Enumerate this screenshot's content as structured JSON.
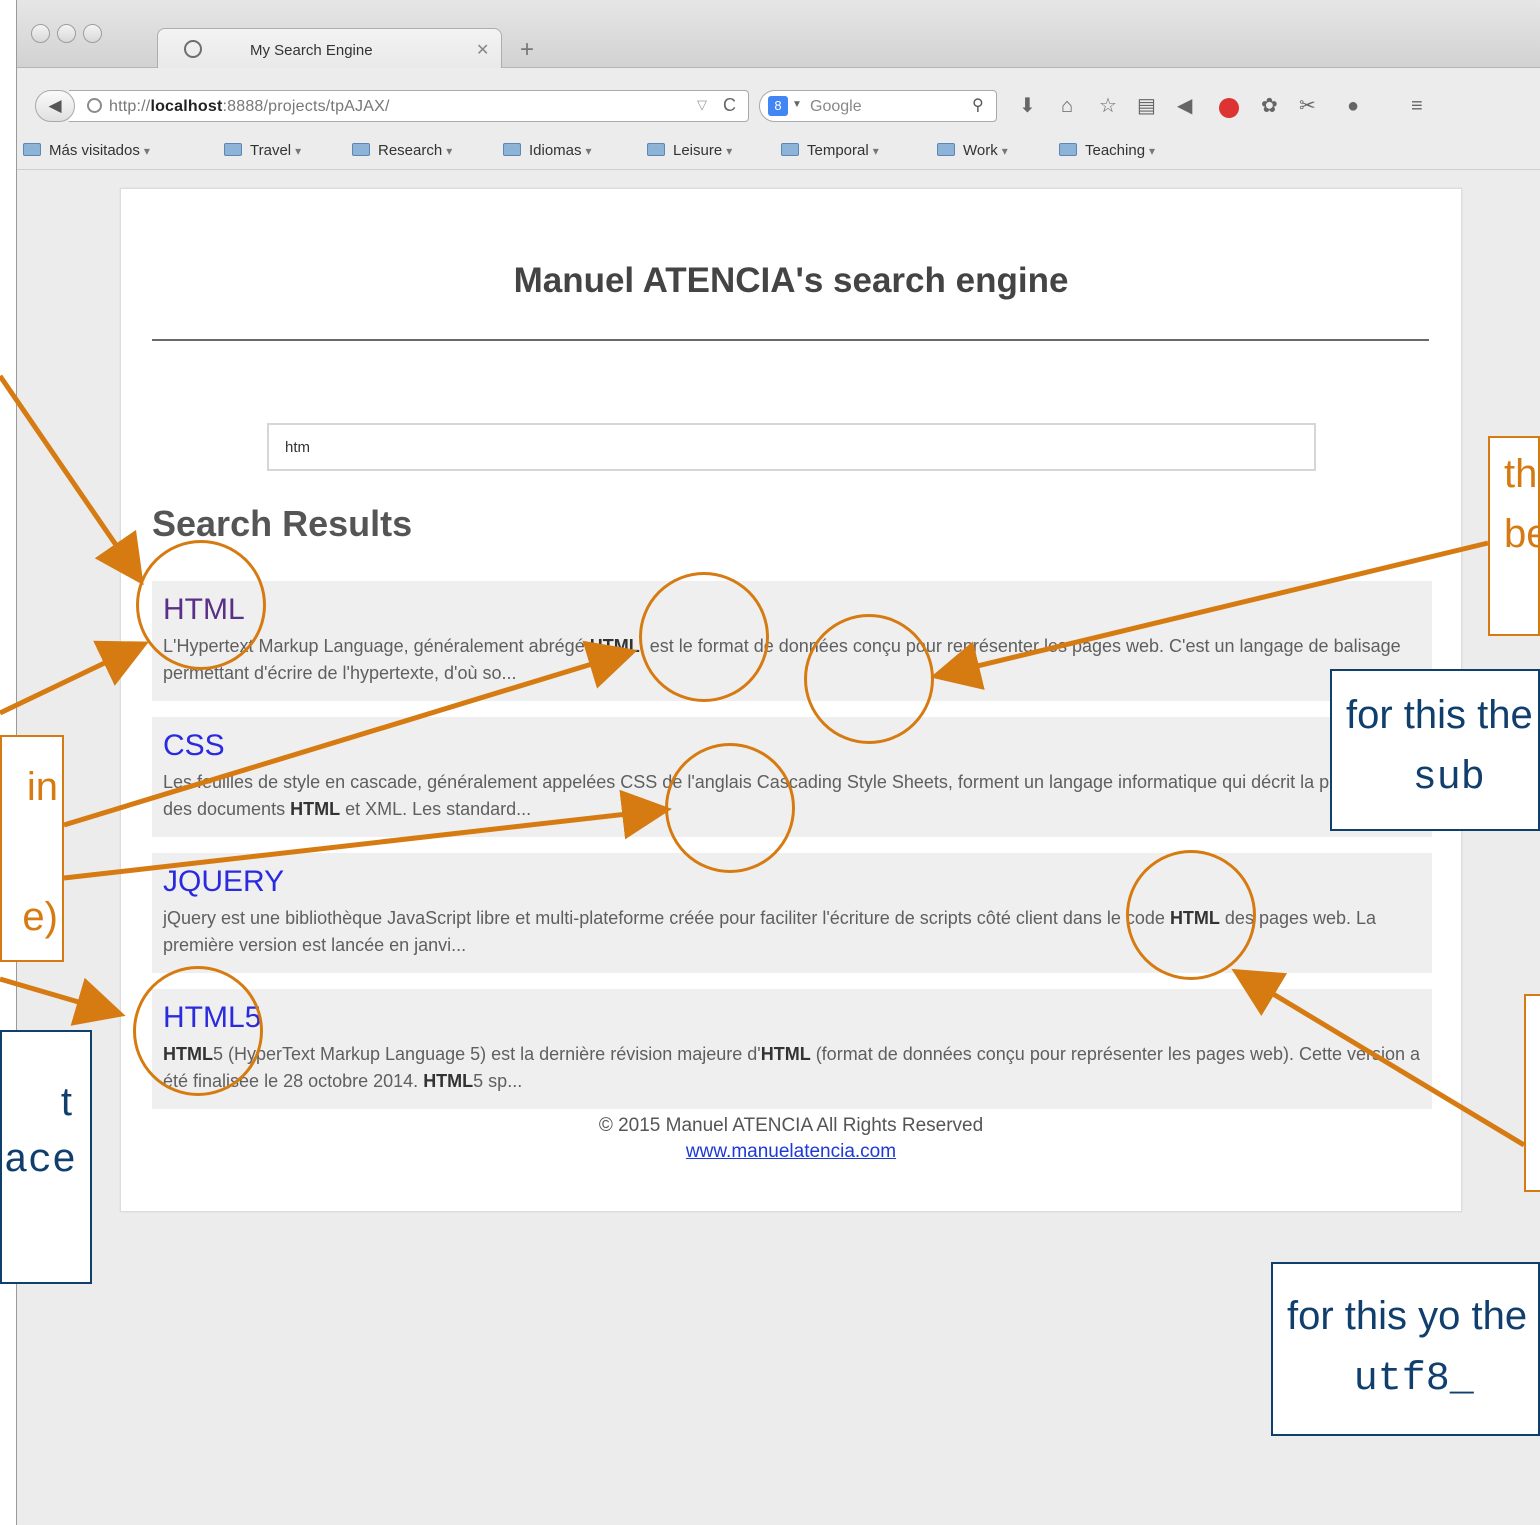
{
  "browser": {
    "tab_title": "My Search Engine",
    "url_prefix": "http://",
    "url_host": "localhost",
    "url_rest": ":8888/projects/tpAJAX/",
    "search_engine_placeholder": "Google",
    "bookmarks": [
      "Más visitados",
      "Travel",
      "Research",
      "Idiomas",
      "Leisure",
      "Temporal",
      "Work",
      "Teaching"
    ]
  },
  "page": {
    "title": "Manuel ATENCIA's search engine",
    "search_value": "htm",
    "results_heading": "Search Results",
    "results": [
      {
        "title": "HTML",
        "visited": true,
        "desc_html": "L'Hypertext Markup Language, généralement abrégé <b>HTML</b>, est le format de données conçu pour représenter les pages web. C'est un langage de balisage permettant d'écrire de l'hypertexte, d'où so..."
      },
      {
        "title": "CSS",
        "visited": false,
        "desc_html": "Les feuilles de style en cascade, généralement appelées CSS de l'anglais Cascading Style Sheets, forment un langage informatique qui décrit la présentation des documents <b>HTML</b> et XML. Les standard..."
      },
      {
        "title": "JQUERY",
        "visited": false,
        "desc_html": "jQuery est une bibliothèque JavaScript libre et multi-plateforme créée pour faciliter l'écriture de scripts côté client dans le code <b>HTML</b> des pages web. La première version est lancée en janvi..."
      },
      {
        "title": "HTML5",
        "visited": false,
        "desc_html": "<b>HTML</b>5 (HyperText Markup Language 5) est la dernière révision majeure d'<b>HTML</b> (format de données conçu pour représenter les pages web). Cette version a été finalisée le 28 octobre 2014. <b>HTML</b>5 sp..."
      }
    ],
    "footer_copyright": "© 2015 Manuel ATENCIA All Rights Reserved",
    "footer_link": "www.manuelatencia.com"
  },
  "annotations": {
    "orange_right": "there num be c",
    "navy_right": "for this the ",
    "navy_right_code": "sub",
    "orange_left_line1": "in",
    "orange_left_line2": "e)",
    "navy_left_line1": "t",
    "navy_left_line2": "ace",
    "navy_bottom": "for this yo the ",
    "navy_bottom_code": "utf8_"
  },
  "colors": {
    "annotation_orange": "#d67b11",
    "annotation_navy": "#103f6e",
    "link_blue": "#2a2adf",
    "link_visited": "#5a2f88"
  }
}
